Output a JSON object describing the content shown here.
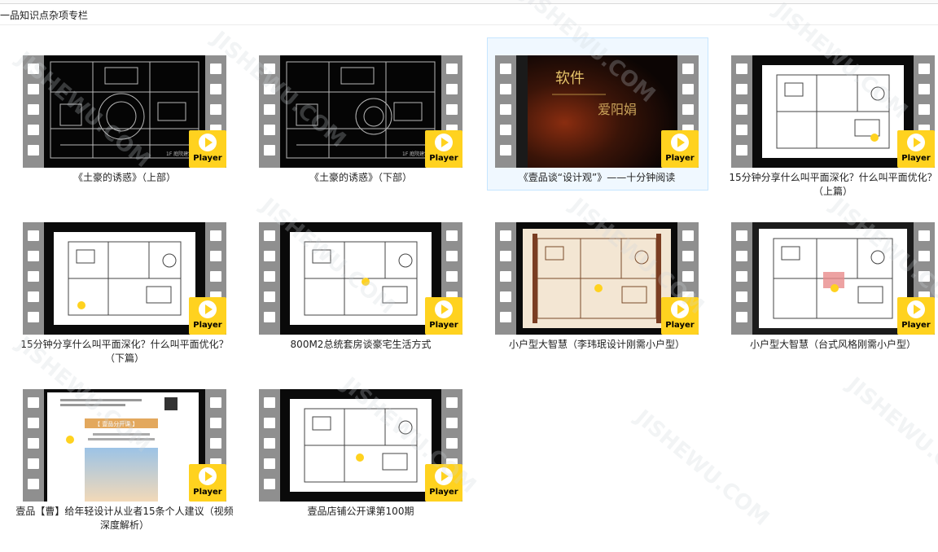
{
  "folder": {
    "path": "一品知识点杂项专栏"
  },
  "badge_label": "Player",
  "watermark": "JISHEWU.COM",
  "items": [
    {
      "caption": "《土豪的诱惑》（上部）",
      "thumb": "cad-dark"
    },
    {
      "caption": "《土豪的诱惑》（下部）",
      "thumb": "cad-dark"
    },
    {
      "caption": "《壹品谈“设计观”》——十分钟阅读",
      "thumb": "title-card",
      "selected": true,
      "frame_text": [
        "软件",
        "爱阳娟"
      ]
    },
    {
      "caption": "15分钟分享什么叫平面深化？什么叫平面优化？（上篇）",
      "thumb": "plan-white"
    },
    {
      "caption": "15分钟分享什么叫平面深化？什么叫平面优化？（下篇）",
      "thumb": "plan-white"
    },
    {
      "caption": "800M2总统套房谈豪宅生活方式",
      "thumb": "plan-white"
    },
    {
      "caption": "小户型大智慧（李玮珉设计刚需小户型）",
      "thumb": "plan-beige"
    },
    {
      "caption": "小户型大智慧（台式风格刚需小户型）",
      "thumb": "plan-grey"
    },
    {
      "caption": "壹品【曹】给年轻设计从业者15条个人建议（视频深度解析）",
      "thumb": "doc",
      "frame_text": [
        "【 壹品分开课 】"
      ]
    },
    {
      "caption": "壹品店铺公开课第100期",
      "thumb": "plan-white"
    }
  ]
}
